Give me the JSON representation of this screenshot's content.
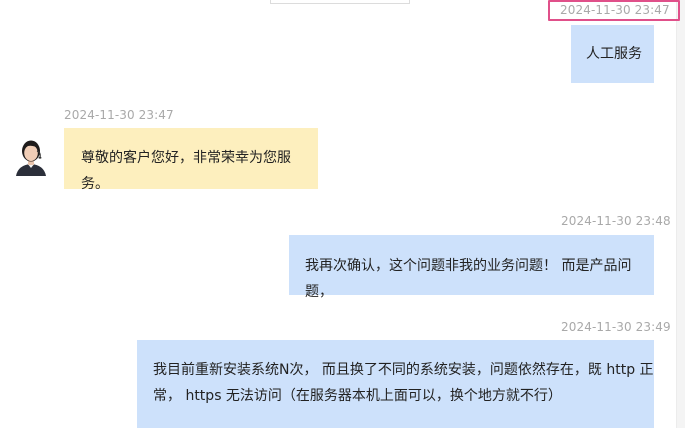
{
  "messages": [
    {
      "side": "out",
      "timestamp": "2024-11-30 23:47",
      "text": "人工服务"
    },
    {
      "side": "in",
      "timestamp": "2024-11-30 23:47",
      "text": "尊敬的客户您好，非常荣幸为您服务。"
    },
    {
      "side": "out",
      "timestamp": "2024-11-30 23:48",
      "text": "我再次确认，这个问题非我的业务问题！ 而是产品问题，"
    },
    {
      "side": "out",
      "timestamp": "2024-11-30 23:49",
      "text_lines": [
        "我目前重新安装系统N次， 而且换了不同的系统安装，问题依然存在，既 http 正",
        "常， https 无法访问（在服务器本机上面可以，换个地方就不行）"
      ]
    }
  ],
  "colors": {
    "outgoing_bubble": "#cde1fb",
    "incoming_bubble": "#fdefbe",
    "timestamp": "#a9a9a9",
    "highlight_border": "#e0508a"
  },
  "icons": {
    "agent_avatar": "agent-avatar-icon"
  }
}
